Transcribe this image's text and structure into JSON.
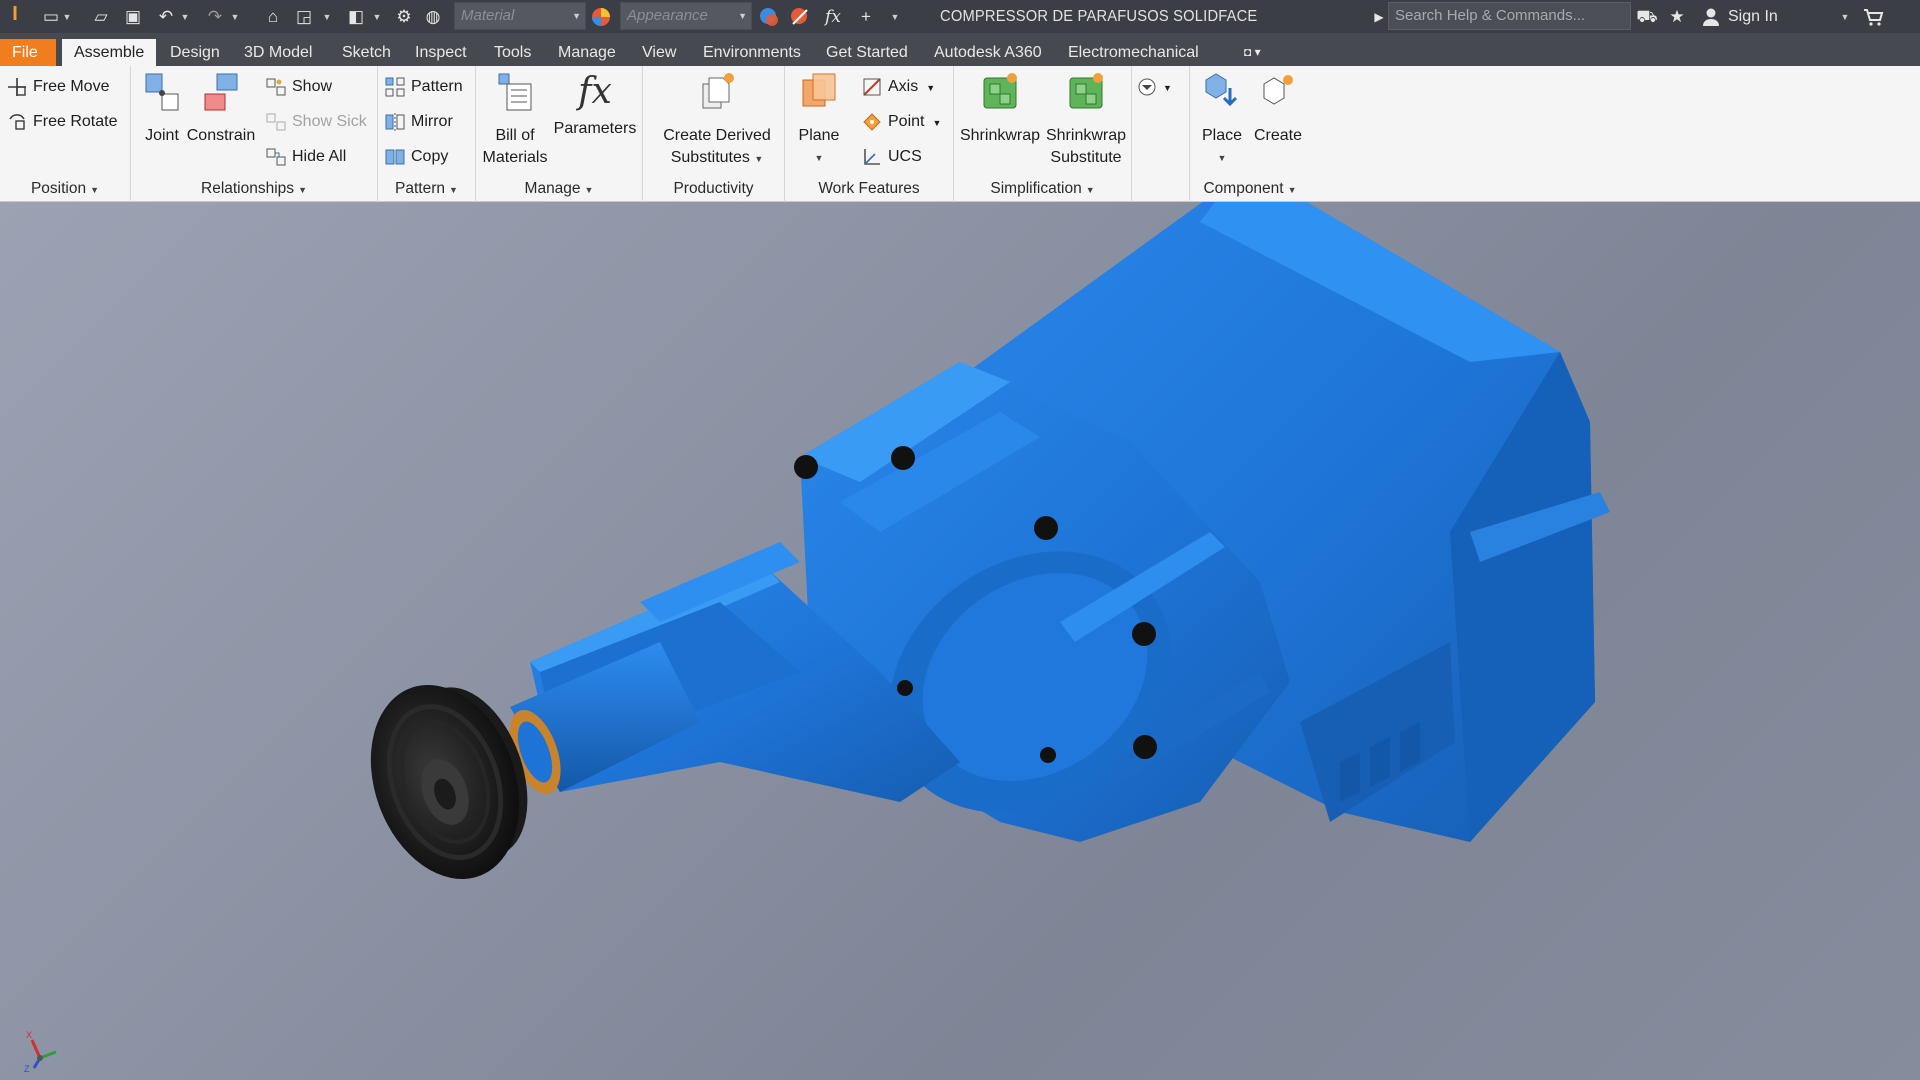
{
  "app": {
    "document_title": "COMPRESSOR DE PARAFUSOS SOLIDFACE",
    "help_search_placeholder": "Search Help & Commands...",
    "sign_in": "Sign In",
    "material_placeholder": "Material",
    "appearance_placeholder": "Appearance",
    "fx_symbol": "fx"
  },
  "tabs": [
    {
      "label": "File"
    },
    {
      "label": "Assemble"
    },
    {
      "label": "Design"
    },
    {
      "label": "3D Model"
    },
    {
      "label": "Sketch"
    },
    {
      "label": "Inspect"
    },
    {
      "label": "Tools"
    },
    {
      "label": "Manage"
    },
    {
      "label": "View"
    },
    {
      "label": "Environments"
    },
    {
      "label": "Get Started"
    },
    {
      "label": "Autodesk A360"
    },
    {
      "label": "Electromechanical"
    }
  ],
  "ribbon": {
    "position": {
      "title": "Position",
      "free_move": "Free Move",
      "free_rotate": "Free Rotate"
    },
    "relationships": {
      "title": "Relationships",
      "joint": "Joint",
      "constrain": "Constrain",
      "show": "Show",
      "show_sick": "Show Sick",
      "hide_all": "Hide All"
    },
    "pattern": {
      "title": "Pattern",
      "pattern": "Pattern",
      "mirror": "Mirror",
      "copy": "Copy"
    },
    "manage": {
      "title": "Manage",
      "bom_line1": "Bill of",
      "bom_line2": "Materials",
      "parameters": "Parameters"
    },
    "productivity": {
      "title": "Productivity",
      "derived_line1": "Create Derived",
      "derived_line2": "Substitutes"
    },
    "work_features": {
      "title": "Work Features",
      "plane": "Plane",
      "axis": "Axis",
      "point": "Point",
      "ucs": "UCS"
    },
    "simplification": {
      "title": "Simplification",
      "shrinkwrap": "Shrinkwrap",
      "shrinkwrap_sub_line1": "Shrinkwrap",
      "shrinkwrap_sub_line2": "Substitute"
    },
    "component": {
      "title": "Component",
      "place": "Place",
      "create": "Create"
    }
  },
  "triad": {
    "x": "X",
    "y": "Y",
    "z": "Z"
  },
  "colors": {
    "model_body": "#1e74d6",
    "file_tab": "#f07d1e",
    "titlebar": "#3b3e44",
    "ribbon": "#f5f5f5"
  }
}
